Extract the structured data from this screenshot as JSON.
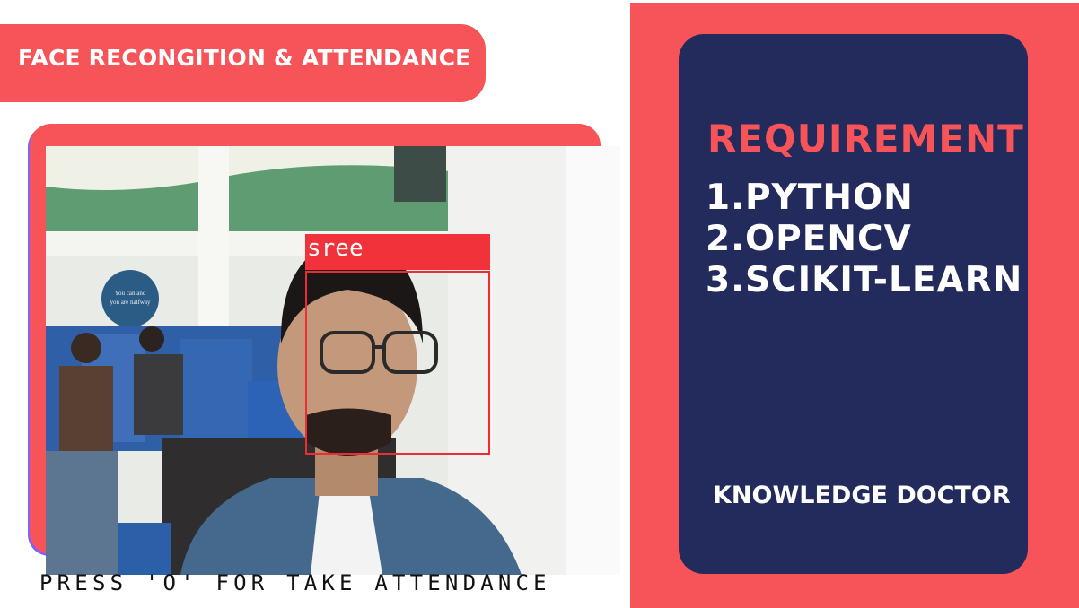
{
  "header": {
    "title": "FACE RECONGITION & ATTENDANCE"
  },
  "camera_feed": {
    "face_label": "sree",
    "caption": "PRESS 'O' FOR TAKE ATTENDANCE",
    "wall_sign_text": "\"Believe You can and you are halfway there\""
  },
  "requirements_panel": {
    "heading": "REQUIREMENT",
    "items": [
      "1.PYTHON",
      "2.OPENCV",
      "3.SCIKIT-LEARN"
    ],
    "credit": "KNOWLEDGE DOCTOR"
  },
  "colors": {
    "coral_accent": "#f65458",
    "navy_card": "#232a5c",
    "face_box_red": "#ef2b34",
    "white": "#ffffff"
  }
}
